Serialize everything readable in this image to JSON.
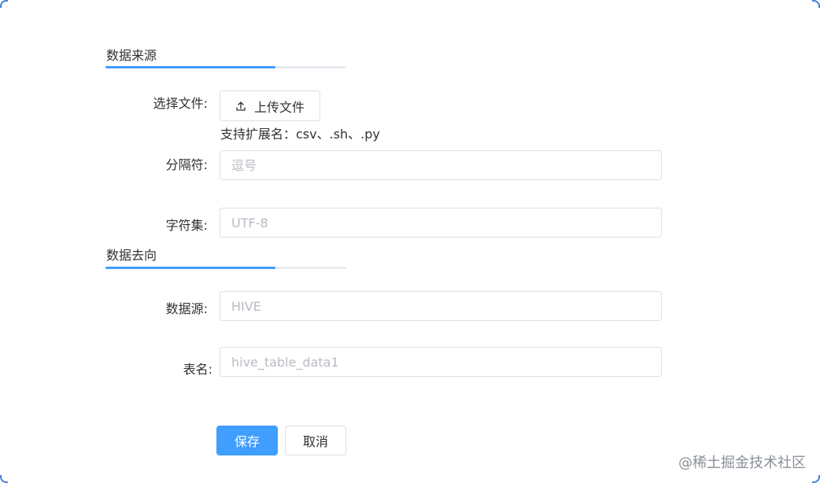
{
  "source_section": {
    "title": "数据来源",
    "file_label": "选择文件:",
    "upload_button": "上传文件",
    "upload_hint": "支持扩展名：csv、.sh、.py",
    "delimiter_label": "分隔符:",
    "delimiter_placeholder": "逗号",
    "charset_label": "字符集:",
    "charset_placeholder": "UTF-8"
  },
  "target_section": {
    "title": "数据去向",
    "datasource_label": "数据源:",
    "datasource_placeholder": "HIVE",
    "table_label": "表名:",
    "table_placeholder": "hive_table_data1"
  },
  "actions": {
    "save": "保存",
    "cancel": "取消"
  },
  "watermark": "@稀土掘金技术社区",
  "colors": {
    "primary": "#409eff",
    "border": "#dcdfe6",
    "placeholder": "#b8bcc4"
  },
  "icons": {
    "upload": "upload-icon"
  }
}
